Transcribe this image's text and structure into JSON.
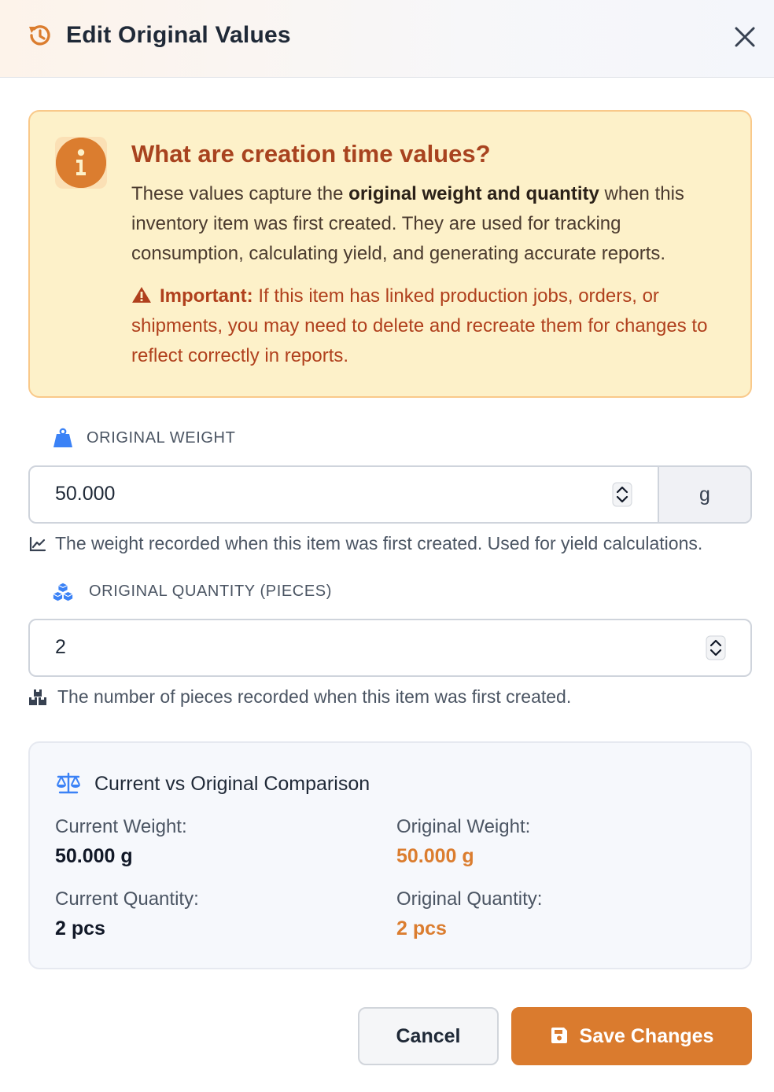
{
  "dialog": {
    "title": "Edit Original Values"
  },
  "info": {
    "heading": "What are creation time values?",
    "text_prefix": "These values capture the ",
    "text_bold": "original weight and quantity",
    "text_suffix": " when this inventory item was first created. They are used for tracking consumption, calculating yield, and generating accurate reports.",
    "warning_label": "Important:",
    "warning_text": " If this item has linked production jobs, orders, or shipments, you may need to delete and recreate them for changes to reflect correctly in reports."
  },
  "weight_field": {
    "label": "ORIGINAL WEIGHT",
    "value": "50.000",
    "unit": "g",
    "hint": "The weight recorded when this item was first created. Used for yield calculations."
  },
  "quantity_field": {
    "label": "ORIGINAL QUANTITY (PIECES)",
    "value": "2",
    "hint": "The number of pieces recorded when this item was first created."
  },
  "comparison": {
    "title": "Current vs Original Comparison",
    "current_weight_label": "Current Weight:",
    "current_weight_value": "50.000 g",
    "original_weight_label": "Original Weight:",
    "original_weight_value": "50.000 g",
    "current_quantity_label": "Current Quantity:",
    "current_quantity_value": "2 pcs",
    "original_quantity_label": "Original Quantity:",
    "original_quantity_value": "2 pcs"
  },
  "actions": {
    "cancel_label": "Cancel",
    "save_label": "Save Changes"
  },
  "icons": {
    "header": "history-icon",
    "close": "close-icon",
    "info": "info-icon",
    "warning": "warning-triangle-icon",
    "weight": "weight-icon",
    "quantity": "cubes-icon",
    "weight_hint": "chart-line-icon",
    "quantity_hint": "boxes-icon",
    "comparison": "balance-scale-icon",
    "save": "floppy-disk-icon"
  },
  "colors": {
    "accent": "#da7b2e",
    "warning_text": "#b0401d",
    "info_bg": "#fdf1c9",
    "icon_blue": "#3b82f6"
  }
}
